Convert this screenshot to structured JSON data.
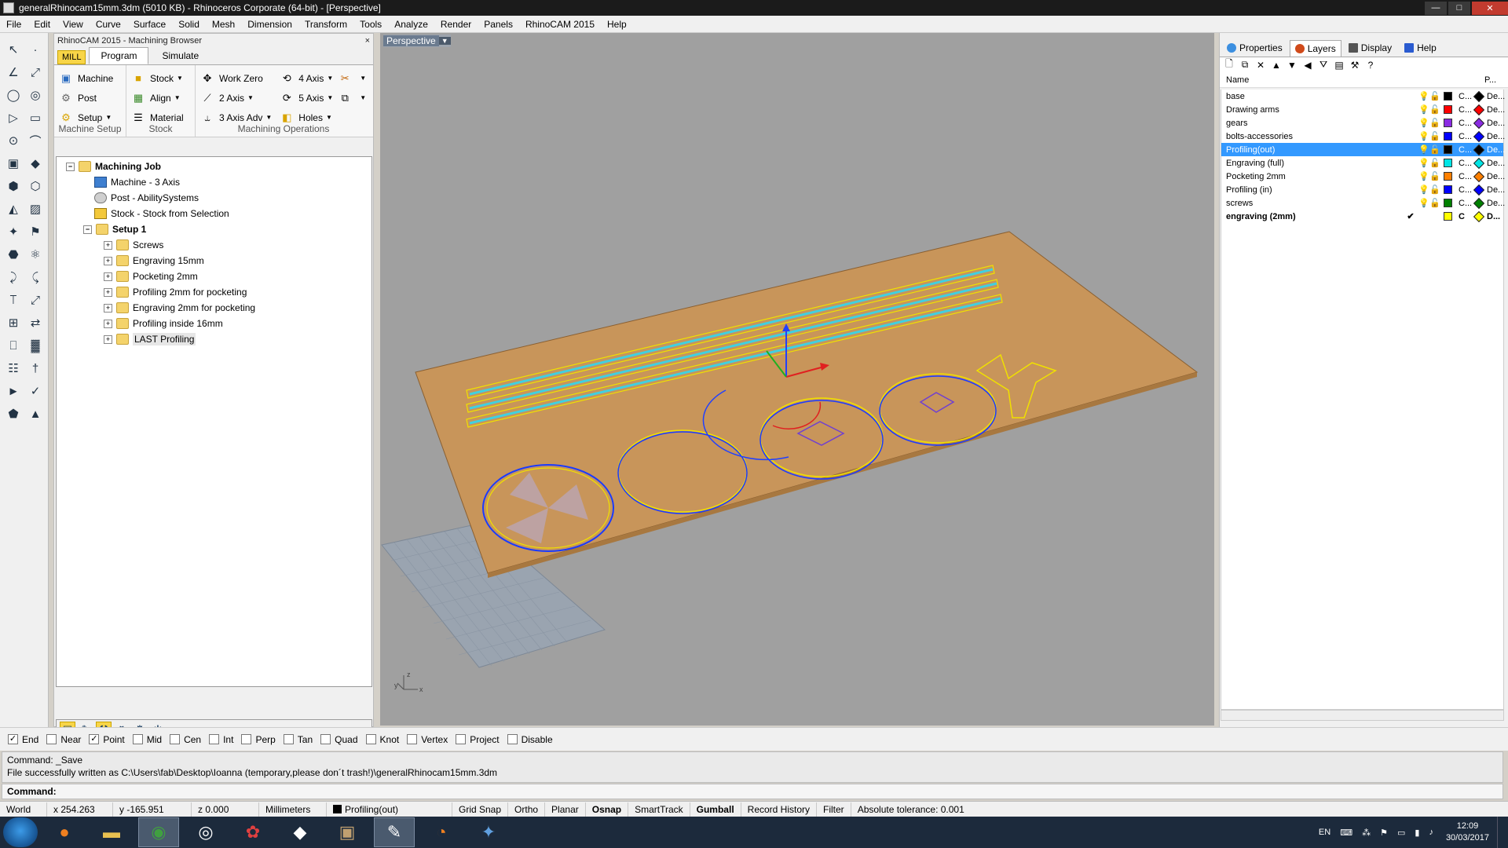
{
  "window": {
    "title": "generalRhinocam15mm.3dm (5010 KB) - Rhinoceros Corporate (64-bit) - [Perspective]",
    "min_glyph": "—",
    "max_glyph": "□",
    "close_glyph": "✕"
  },
  "menu": [
    "File",
    "Edit",
    "View",
    "Curve",
    "Surface",
    "Solid",
    "Mesh",
    "Dimension",
    "Transform",
    "Tools",
    "Analyze",
    "Render",
    "Panels",
    "RhinoCAM 2015",
    "Help"
  ],
  "left_tools": [
    "↖",
    "·",
    "∠",
    "⤢",
    "◯",
    "◎",
    "▷",
    "▭",
    "⊙",
    "⌒",
    "▣",
    "◆",
    "⬢",
    "⬡",
    "◭",
    "▨",
    "✦",
    "⚑",
    "⬣",
    "⚛",
    "⤸",
    "⤹",
    "⟙",
    "⤢",
    "⊞",
    "⇄",
    "⎕",
    "▓",
    "☷",
    "†",
    "►",
    "✓",
    "⬟",
    "▲"
  ],
  "machining_browser": {
    "title": "RhinoCAM 2015 - Machining Browser",
    "close_glyph": "×",
    "mill_label": "MILL",
    "tabs": [
      "Program",
      "Simulate"
    ],
    "machine_setup": {
      "machine": "Machine",
      "post": "Post",
      "setup": "Setup",
      "label": "Machine Setup"
    },
    "stock": {
      "stock": "Stock",
      "align": "Align",
      "material": "Material",
      "label": "Stock"
    },
    "ops": {
      "work_zero": "Work Zero",
      "two_axis": "2 Axis",
      "three_axis_adv": "3 Axis Adv",
      "four_axis": "4 Axis",
      "five_axis": "5 Axis",
      "holes": "Holes",
      "label": "Machining Operations"
    },
    "tree": {
      "root": "Machining Job",
      "machine": "Machine - 3 Axis",
      "post": "Post - AbilitySystems",
      "stock": "Stock - Stock from Selection",
      "setup": "Setup 1",
      "ops": [
        "Screws",
        "Engraving 15mm",
        "Pocketing 2mm",
        "Profiling 2mm for pocketing",
        "Engraving 2mm for pocketing",
        "Profiling inside 16mm",
        "LAST Profiling"
      ]
    }
  },
  "viewport": {
    "label": "Perspective",
    "axis_x": "x",
    "axis_y": "y",
    "axis_z": "z"
  },
  "layers_panel": {
    "tabs": [
      "Properties",
      "Layers",
      "Display",
      "Help"
    ],
    "columns": {
      "name": "Name",
      "p": "P..."
    },
    "layers": [
      {
        "name": "base",
        "color": "#000000",
        "mat": "C...",
        "print_color": "#000000",
        "lt": "De..."
      },
      {
        "name": "Drawing arms",
        "color": "#ff0000",
        "mat": "C...",
        "print_color": "#ff0000",
        "lt": "De..."
      },
      {
        "name": "gears",
        "color": "#8a2be2",
        "mat": "C...",
        "print_color": "#8a2be2",
        "lt": "De..."
      },
      {
        "name": "bolts-accessories",
        "color": "#0000ff",
        "mat": "C...",
        "print_color": "#0000ff",
        "lt": "De..."
      },
      {
        "name": "Profiling(out)",
        "color": "#000000",
        "mat": "C...",
        "print_color": "#000000",
        "lt": "De..."
      },
      {
        "name": "Engraving (full)",
        "color": "#00e5e5",
        "mat": "C...",
        "print_color": "#00e5e5",
        "lt": "De..."
      },
      {
        "name": "Pocketing 2mm",
        "color": "#ff8000",
        "mat": "C...",
        "print_color": "#ff8000",
        "lt": "De..."
      },
      {
        "name": "Profiling (in)",
        "color": "#0000ff",
        "mat": "C...",
        "print_color": "#0000ff",
        "lt": "De..."
      },
      {
        "name": "screws",
        "color": "#008000",
        "mat": "C...",
        "print_color": "#008000",
        "lt": "De..."
      },
      {
        "name": "engraving (2mm)",
        "color": "#ffff00",
        "mat": "C",
        "print_color": "#ffff00",
        "lt": "D...",
        "current_mark": "✔"
      }
    ]
  },
  "osnaps": [
    {
      "label": "End",
      "checked": true
    },
    {
      "label": "Near",
      "checked": false
    },
    {
      "label": "Point",
      "checked": true
    },
    {
      "label": "Mid",
      "checked": false
    },
    {
      "label": "Cen",
      "checked": false
    },
    {
      "label": "Int",
      "checked": false
    },
    {
      "label": "Perp",
      "checked": false
    },
    {
      "label": "Tan",
      "checked": false
    },
    {
      "label": "Quad",
      "checked": false
    },
    {
      "label": "Knot",
      "checked": false
    },
    {
      "label": "Vertex",
      "checked": false
    },
    {
      "label": "Project",
      "checked": false
    },
    {
      "label": "Disable",
      "checked": false
    }
  ],
  "command": {
    "history_1": "Command: _Save",
    "history_2": "File successfully written as C:\\Users\\fab\\Desktop\\Ioanna (temporary,please don´t trash!)\\generalRhinocam15mm.3dm",
    "prompt": "Command:"
  },
  "status": {
    "cplane": "World",
    "x": "x 254.263",
    "y": "y -165.951",
    "z": "z 0.000",
    "units": "Millimeters",
    "layer": "Profiling(out)",
    "grid_snap": "Grid Snap",
    "ortho": "Ortho",
    "planar": "Planar",
    "osnap": "Osnap",
    "smarttrack": "SmartTrack",
    "gumball": "Gumball",
    "record_history": "Record History",
    "filter": "Filter",
    "tolerance": "Absolute tolerance: 0.001"
  },
  "taskbar": {
    "lang": "EN",
    "time": "12:09",
    "date": "30/03/2017"
  },
  "colors": {
    "stock_plate": "#c8955a",
    "viewport_bg": "#a0a0a0",
    "selection": "#3399ff",
    "accent_yellow": "#f8d548"
  }
}
